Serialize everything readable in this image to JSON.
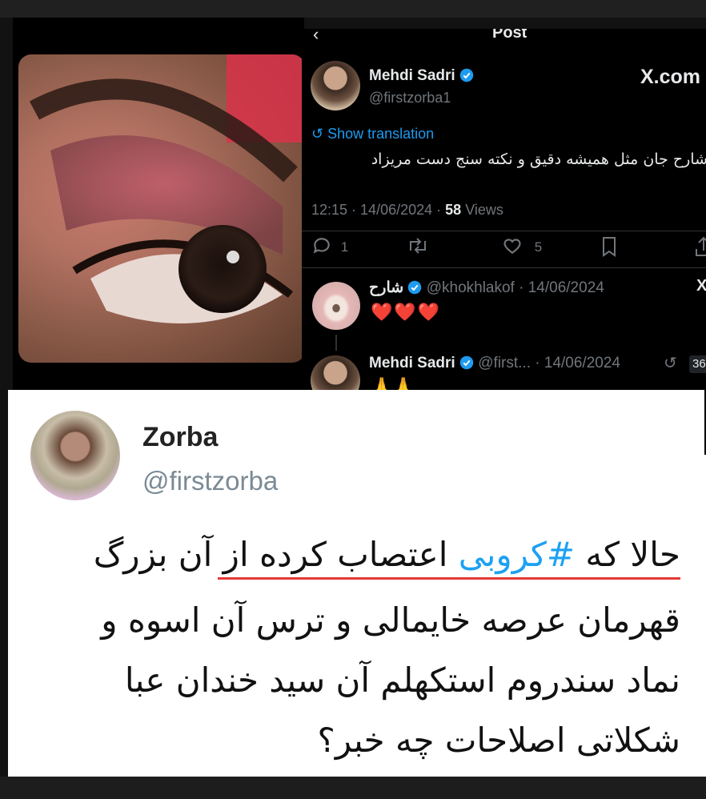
{
  "post_header": {
    "title": "Post"
  },
  "main_post": {
    "author_name": "Mehdi Sadri",
    "handle": "@firstzorba1",
    "brand": "X.com",
    "translate_label": "Show translation",
    "body": "شارح جان مثل همیشه دقیق و نکته سنج دست مریزاد",
    "time": "12:15",
    "date": "14/06/2024",
    "views_count": "58",
    "views_label": "Views",
    "replies": "1",
    "likes": "5"
  },
  "reply_1": {
    "author_name": "شارح",
    "handle": "@khokhlakof",
    "date": "14/06/2024",
    "body": "❤️❤️❤️"
  },
  "reply_2": {
    "author_name": "Mehdi Sadri",
    "handle": "@first...",
    "date": "14/06/2024",
    "badge": "36",
    "body": "🙏🙏"
  },
  "zorba": {
    "name": "Zorba",
    "handle": "@firstzorba",
    "line1_a": "حالا که",
    "line1_hashtag": "#کروبی",
    "line1_b": "اعتصاب کرده از آن بزرگ",
    "line2": "قهرمان عرصه خایمالی و ترس آن اسوه و",
    "line3": "نماد سندروم استکهلم آن سید خندان عبا",
    "line4": "شکلاتی اصلاحات چه خبر؟"
  },
  "colors": {
    "x_blue": "#1d9bf0",
    "underline_red": "#e53935",
    "hashtag_blue": "#1da1f2"
  }
}
